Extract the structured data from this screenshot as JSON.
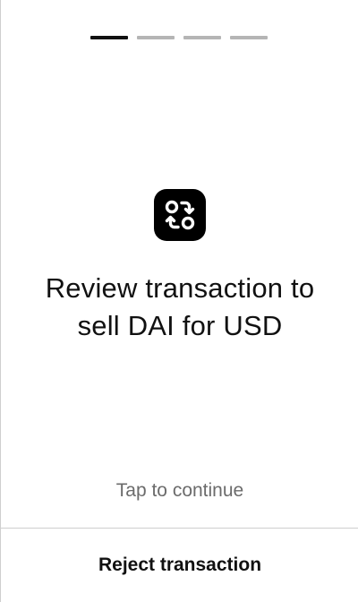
{
  "progress": {
    "total_steps": 4,
    "current_step": 1
  },
  "main": {
    "icon": "swap-arrows-icon",
    "title_line1": "Review transaction to",
    "title_line2": "sell DAI for USD",
    "tap_hint": "Tap to continue"
  },
  "footer": {
    "reject_label": "Reject transaction"
  },
  "colors": {
    "background": "#ffffff",
    "text": "#111111",
    "muted_text": "#6b6b6b",
    "active_segment": "#111111",
    "inactive_segment": "#b5b5b5",
    "icon_tile": "#000000",
    "divider": "#cfcfcf"
  }
}
